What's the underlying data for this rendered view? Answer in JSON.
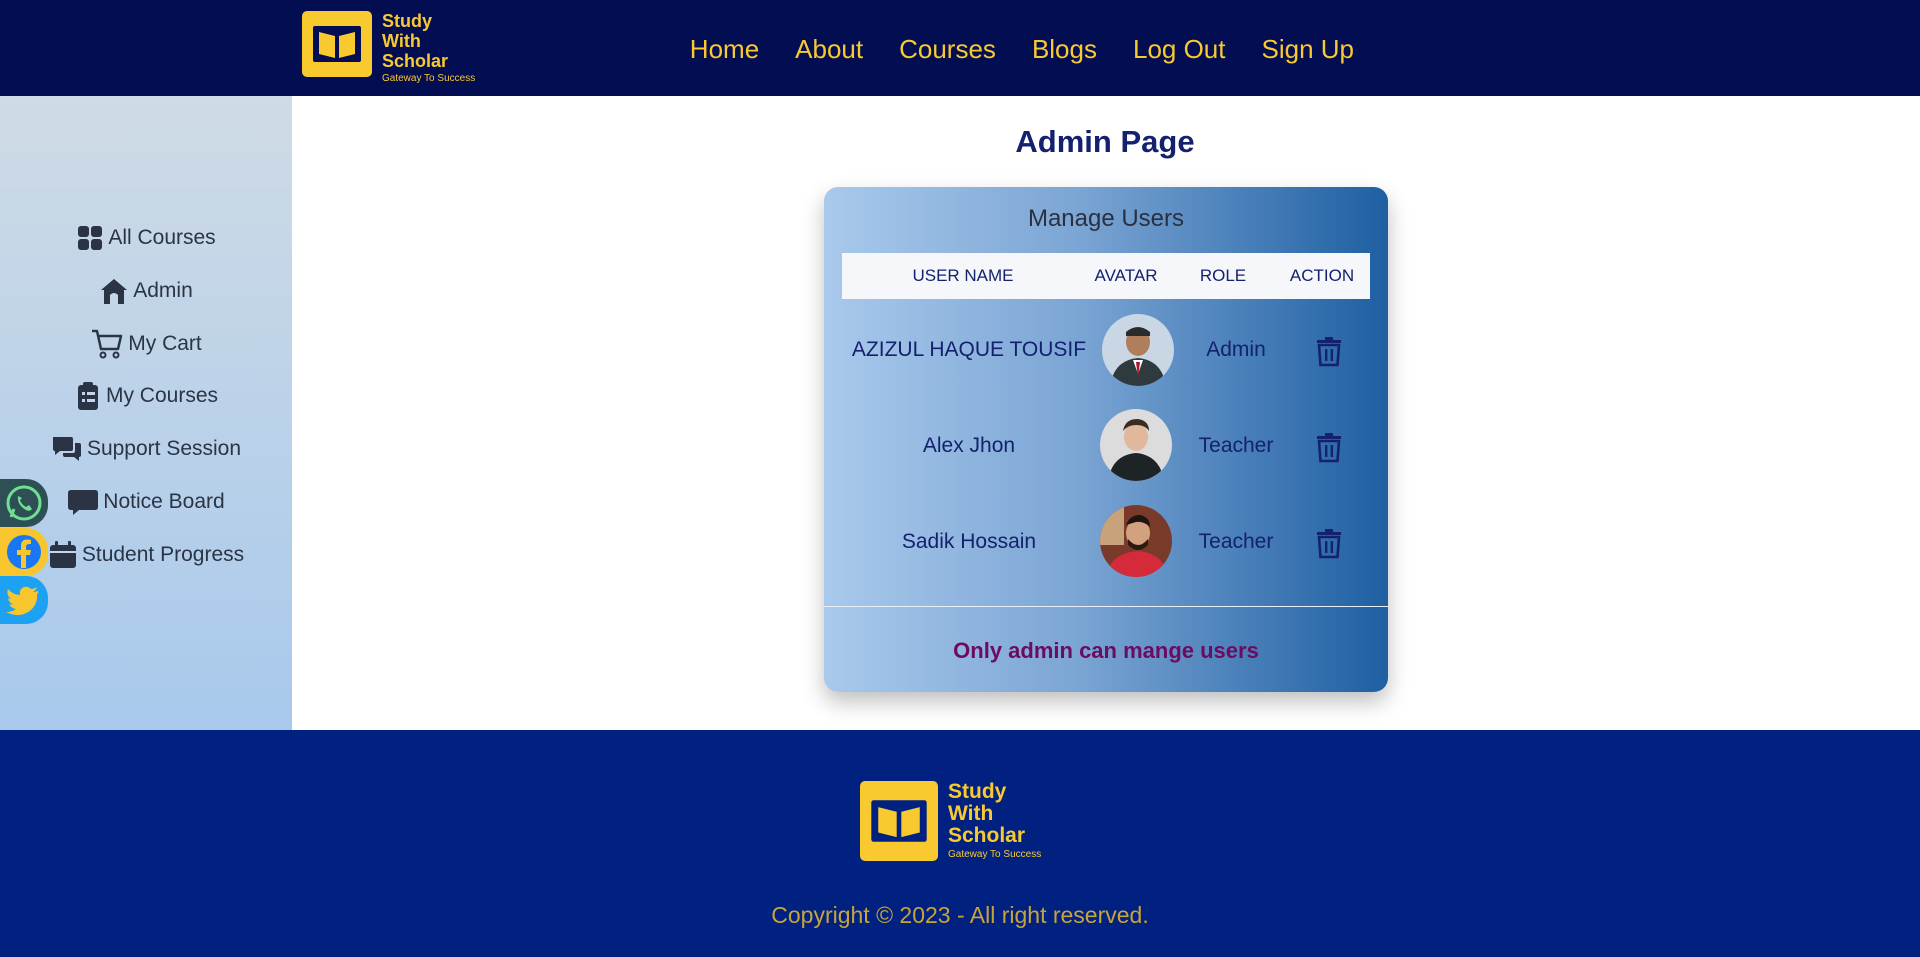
{
  "brand": {
    "line1": "Study",
    "line2": "With",
    "line3": "Scholar",
    "tagline": "Gateway To Success",
    "color": "#f9c930"
  },
  "nav": [
    {
      "label": "Home"
    },
    {
      "label": "About"
    },
    {
      "label": "Courses"
    },
    {
      "label": "Blogs"
    },
    {
      "label": "Log Out"
    },
    {
      "label": "Sign Up"
    }
  ],
  "sidebar": {
    "items": [
      {
        "label": "All Courses",
        "icon": "grid-icon"
      },
      {
        "label": "Admin",
        "icon": "home-icon"
      },
      {
        "label": "My Cart",
        "icon": "cart-icon"
      },
      {
        "label": "My Courses",
        "icon": "clipboard-icon"
      },
      {
        "label": "Support Session",
        "icon": "chat-icon"
      },
      {
        "label": "Notice Board",
        "icon": "message-icon"
      },
      {
        "label": "Student Progress",
        "icon": "calendar-icon"
      }
    ]
  },
  "social": [
    {
      "icon": "whatsapp-icon"
    },
    {
      "icon": "facebook-icon"
    },
    {
      "icon": "twitter-icon"
    }
  ],
  "main": {
    "title": "Admin Page",
    "card_title": "Manage Users",
    "columns": [
      "USER NAME",
      "AVATAR",
      "ROLE",
      "ACTION"
    ],
    "rows": [
      {
        "name": "AZIZUL HAQUE TOUSIF",
        "role": "Admin",
        "avatar": "avatar-tousif"
      },
      {
        "name": "Alex Jhon",
        "role": "Teacher",
        "avatar": "avatar-alex"
      },
      {
        "name": "Sadik Hossain",
        "role": "Teacher",
        "avatar": "avatar-sadik"
      }
    ],
    "note": "Only admin can mange users"
  },
  "footer": {
    "brand": {
      "line1": "Study",
      "line2": "With",
      "line3": "Scholar",
      "tagline": "Gateway To Success"
    },
    "copyright": "Copyright © 2023 - All right reserved."
  }
}
